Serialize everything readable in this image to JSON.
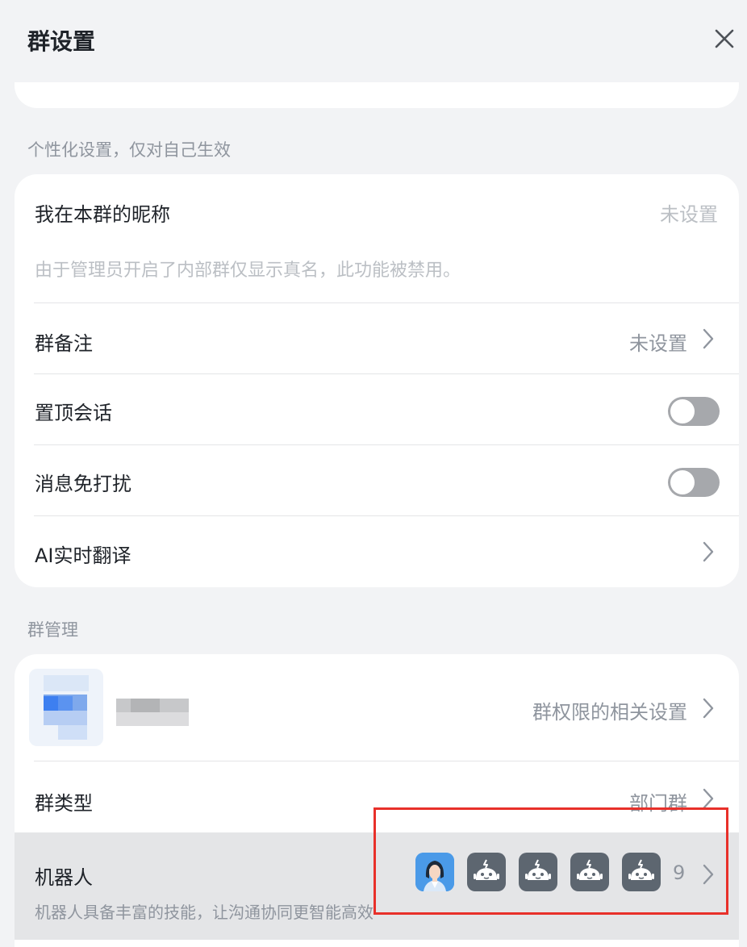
{
  "header": {
    "title": "群设置"
  },
  "personal": {
    "section_label": "个性化设置，仅对自己生效",
    "nickname_label": "我在本群的昵称",
    "nickname_value": "未设置",
    "nickname_hint": "由于管理员开启了内部群仅显示真名，此功能被禁用。",
    "remark_label": "群备注",
    "remark_value": "未设置",
    "pin_label": "置顶会话",
    "pin_on": false,
    "mute_label": "消息免打扰",
    "mute_on": false,
    "translate_label": "AI实时翻译"
  },
  "manage": {
    "section_label": "群管理",
    "permission_value": "群权限的相关设置",
    "type_label": "群类型",
    "type_value": "部门群",
    "bot_label": "机器人",
    "bot_desc": "机器人具备丰富的技能，让沟通协同更智能高效",
    "bot_count": "9"
  },
  "icons": {
    "close": "close-icon",
    "chevron": "chevron-right-icon",
    "bot": "robot-icon",
    "avatar": "woman-avatar-icon"
  },
  "colors": {
    "background": "#f2f3f5",
    "card": "#ffffff",
    "text": "#1f2329",
    "secondary": "#8f959e",
    "toggle_off": "#a6a8ac",
    "bot_icon": "#5d6670",
    "highlight": "#e8302a",
    "selected_row": "#e4e5e7"
  }
}
